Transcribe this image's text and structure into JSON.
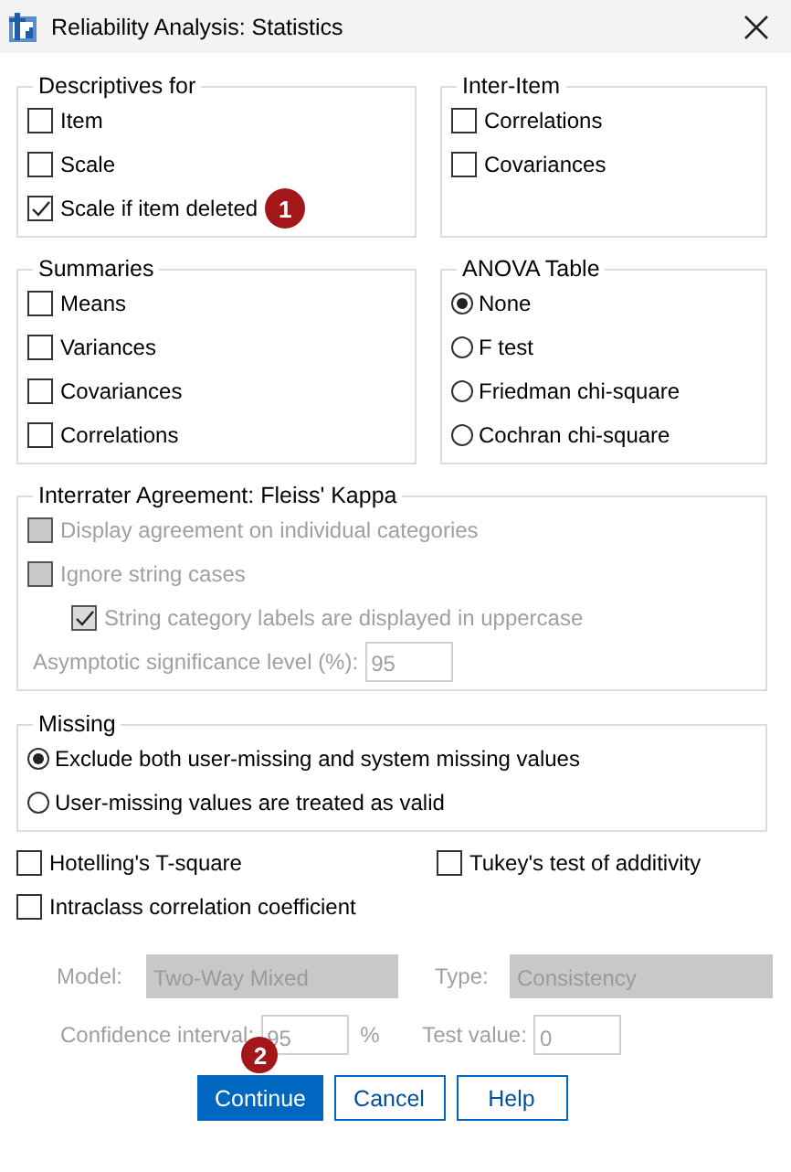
{
  "window": {
    "title": "Reliability Analysis: Statistics"
  },
  "descriptives": {
    "title": "Descriptives for",
    "items": [
      {
        "label": "Item",
        "checked": false
      },
      {
        "label": "Scale",
        "checked": false
      },
      {
        "label": "Scale if item deleted",
        "checked": true,
        "annotation": "1"
      }
    ]
  },
  "inter_item": {
    "title": "Inter-Item",
    "items": [
      {
        "label": "Correlations",
        "checked": false
      },
      {
        "label": "Covariances",
        "checked": false
      }
    ]
  },
  "summaries": {
    "title": "Summaries",
    "items": [
      {
        "label": "Means",
        "checked": false
      },
      {
        "label": "Variances",
        "checked": false
      },
      {
        "label": "Covariances",
        "checked": false
      },
      {
        "label": "Correlations",
        "checked": false
      }
    ]
  },
  "anova": {
    "title": "ANOVA Table",
    "options": [
      {
        "label": "None",
        "selected": true
      },
      {
        "label": "F test",
        "selected": false
      },
      {
        "label": "Friedman chi-square",
        "selected": false
      },
      {
        "label": "Cochran chi-square",
        "selected": false
      }
    ]
  },
  "interrater": {
    "title": "Interrater Agreement: Fleiss' Kappa",
    "disabled": true,
    "items": [
      {
        "label": "Display agreement on individual categories",
        "checked": false
      },
      {
        "label": "Ignore string cases",
        "checked": false,
        "children": [
          {
            "label": "String category labels are displayed in uppercase",
            "checked": true
          }
        ]
      }
    ],
    "significance": {
      "label": "Asymptotic significance level (%):",
      "value": "95"
    }
  },
  "missing": {
    "title": "Missing",
    "options": [
      {
        "label": "Exclude both user-missing and system missing values",
        "selected": true
      },
      {
        "label": "User-missing values are treated as valid",
        "selected": false
      }
    ]
  },
  "extra_checks": [
    {
      "label": "Hotelling's T-square",
      "checked": false
    },
    {
      "label": "Tukey's test of additivity",
      "checked": false
    },
    {
      "label": "Intraclass correlation coefficient",
      "checked": false
    }
  ],
  "icc": {
    "disabled": true,
    "model_label": "Model:",
    "model_value": "Two-Way Mixed",
    "type_label": "Type:",
    "type_value": "Consistency",
    "confidence_label": "Confidence interval:",
    "confidence_value": "95",
    "percent": "%",
    "test_label": "Test value:",
    "test_value": "0"
  },
  "buttons": [
    {
      "label": "Continue",
      "primary": true,
      "annotation": "2"
    },
    {
      "label": "Cancel",
      "primary": false
    },
    {
      "label": "Help",
      "primary": false
    }
  ]
}
